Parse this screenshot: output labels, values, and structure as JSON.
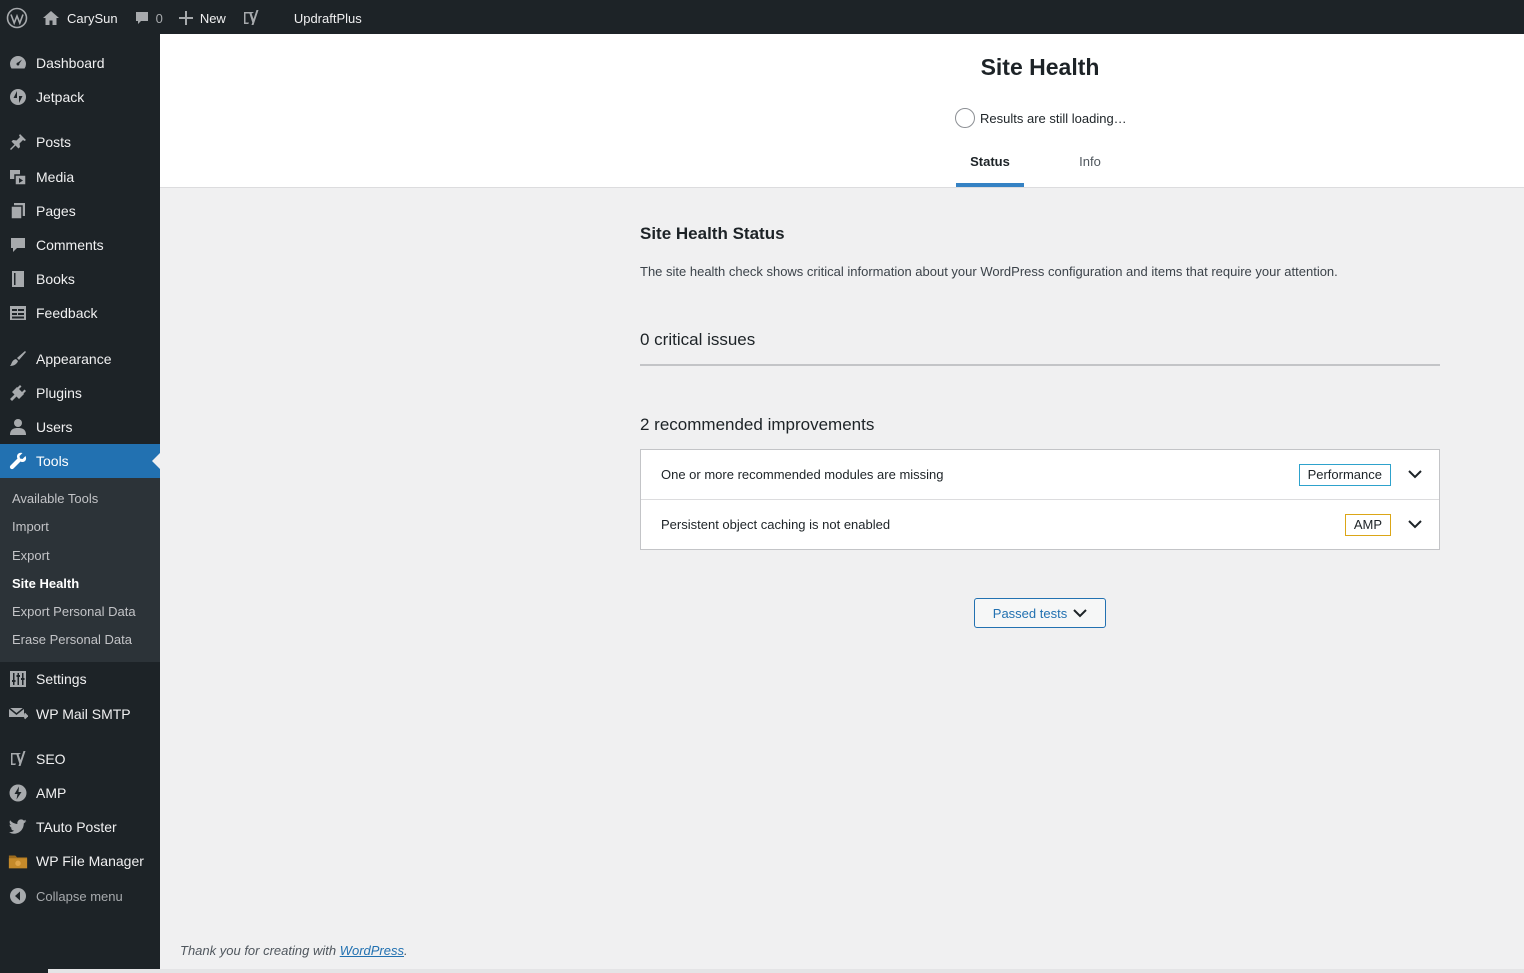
{
  "adminbar": {
    "site_name": "CarySun",
    "comments_count": "0",
    "new_label": "New",
    "updraft_label": "UpdraftPlus"
  },
  "sidebar": {
    "items": [
      {
        "label": "Dashboard",
        "icon": "dashboard-icon"
      },
      {
        "label": "Jetpack",
        "icon": "jetpack-icon"
      },
      {
        "label": "Posts",
        "icon": "pin-icon"
      },
      {
        "label": "Media",
        "icon": "media-icon"
      },
      {
        "label": "Pages",
        "icon": "pages-icon"
      },
      {
        "label": "Comments",
        "icon": "comment-icon"
      },
      {
        "label": "Books",
        "icon": "book-icon"
      },
      {
        "label": "Feedback",
        "icon": "feedback-icon"
      },
      {
        "label": "Appearance",
        "icon": "brush-icon"
      },
      {
        "label": "Plugins",
        "icon": "plug-icon"
      },
      {
        "label": "Users",
        "icon": "user-icon"
      },
      {
        "label": "Tools",
        "icon": "wrench-icon"
      },
      {
        "label": "Settings",
        "icon": "settings-icon"
      },
      {
        "label": "WP Mail SMTP",
        "icon": "mail-icon"
      },
      {
        "label": "SEO",
        "icon": "yoast-icon"
      },
      {
        "label": "AMP",
        "icon": "amp-icon"
      },
      {
        "label": "TAuto Poster",
        "icon": "twitter-icon"
      },
      {
        "label": "WP File Manager",
        "icon": "folder-icon"
      }
    ],
    "submenu": [
      "Available Tools",
      "Import",
      "Export",
      "Site Health",
      "Export Personal Data",
      "Erase Personal Data"
    ],
    "collapse_label": "Collapse menu"
  },
  "header": {
    "title": "Site Health",
    "loading_text": "Results are still loading…",
    "tabs": [
      "Status",
      "Info"
    ]
  },
  "main": {
    "title": "Site Health Status",
    "description": "The site health check shows critical information about your WordPress configuration and items that require your attention.",
    "critical_title": "0 critical issues",
    "recommended_title": "2 recommended improvements",
    "issues": [
      {
        "label": "One or more recommended modules are missing",
        "badge": "Performance"
      },
      {
        "label": "Persistent object caching is not enabled",
        "badge": "AMP"
      }
    ],
    "passed_tests_label": "Passed tests"
  },
  "footer": {
    "text": "Thank you for creating with ",
    "link": "WordPress",
    "period": "."
  },
  "colors": {
    "adminbar_bg": "#1d2327",
    "active_menu": "#2271b1",
    "performance_badge": "#2271b1",
    "amp_badge": "#dba617"
  }
}
